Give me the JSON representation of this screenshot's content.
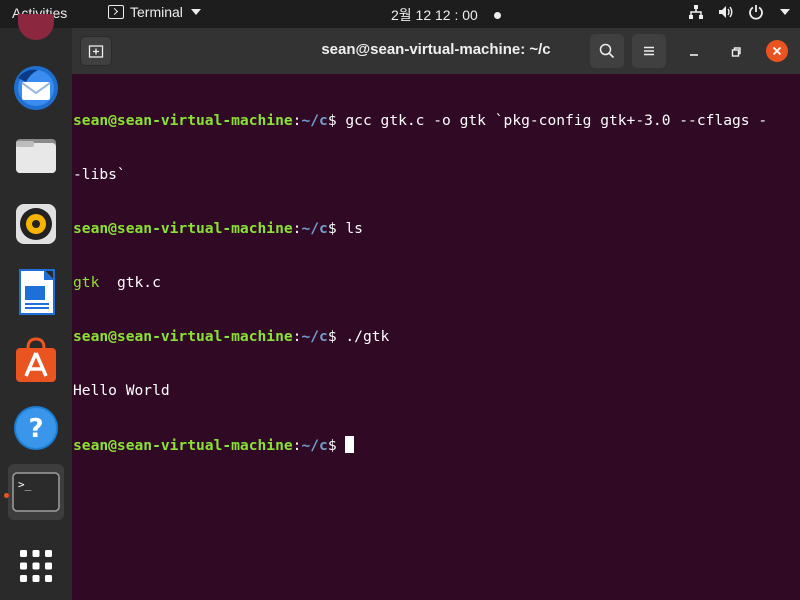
{
  "topbar": {
    "activities": "Activities",
    "app_name": "Terminal",
    "clock": "2월 12  12 : 00"
  },
  "dock": {
    "items": [
      {
        "name": "thunderbird-icon"
      },
      {
        "name": "files-icon"
      },
      {
        "name": "rhythmbox-icon"
      },
      {
        "name": "libreoffice-writer-icon"
      },
      {
        "name": "software-icon"
      },
      {
        "name": "help-icon"
      },
      {
        "name": "terminal-icon"
      },
      {
        "name": "show-apps-icon"
      }
    ]
  },
  "window": {
    "title": "sean@sean-virtual-machine: ~/c"
  },
  "terminal": {
    "user_host": "sean@sean-virtual-machine",
    "path": "~/c",
    "prompt_colon": ":",
    "prompt_end": "$ ",
    "cmd1": "gcc gtk.c -o gtk `pkg-config gtk+-3.0 --cflags -",
    "cmd1_wrap": "-libs`",
    "cmd2": "ls",
    "out2_a": "gtk",
    "out2_sep": "  ",
    "out2_b": "gtk.c",
    "cmd3": "./gtk",
    "out3": "Hello World"
  },
  "colors": {
    "terminal_bg": "#300a24",
    "prompt_user": "#8ae234",
    "prompt_path": "#729fcf",
    "close_button": "#e95420"
  }
}
